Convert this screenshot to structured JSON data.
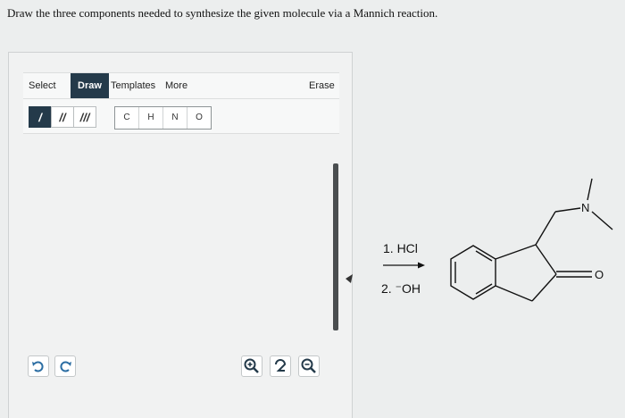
{
  "question": {
    "text": "Draw the three components needed to synthesize the given molecule via a Mannich reaction."
  },
  "editor": {
    "tabs": [
      "Select",
      "Draw",
      "Templates",
      "More"
    ],
    "active_tab": "Draw",
    "erase_label": "Erase",
    "bond_tools": [
      "/",
      "//",
      "///"
    ],
    "atoms": [
      "C",
      "H",
      "N",
      "O"
    ],
    "accent_color": "#243a4a"
  },
  "reaction": {
    "step1": "1. HCl",
    "step2": "2. ⁻OH",
    "n_label": "N",
    "o_label": "O"
  }
}
